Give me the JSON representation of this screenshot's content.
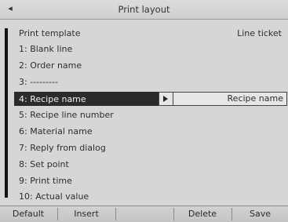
{
  "window": {
    "title": "Print layout",
    "back_icon": "◂"
  },
  "header": {
    "label": "Print template",
    "value": "Line ticket"
  },
  "rows": [
    {
      "label": "1: Blank line"
    },
    {
      "label": "2: Order name"
    },
    {
      "label": "3: ---------"
    },
    {
      "label": "4: Recipe name",
      "value": "Recipe name",
      "selected": true
    },
    {
      "label": "5: Recipe line number"
    },
    {
      "label": "6: Material name"
    },
    {
      "label": "7: Reply from dialog"
    },
    {
      "label": "8: Set point"
    },
    {
      "label": "9: Print time"
    },
    {
      "label": "10: Actual value"
    }
  ],
  "softkeys": {
    "default": "Default",
    "insert": "Insert",
    "empty1": "",
    "delete": "Delete",
    "save": "Save"
  }
}
